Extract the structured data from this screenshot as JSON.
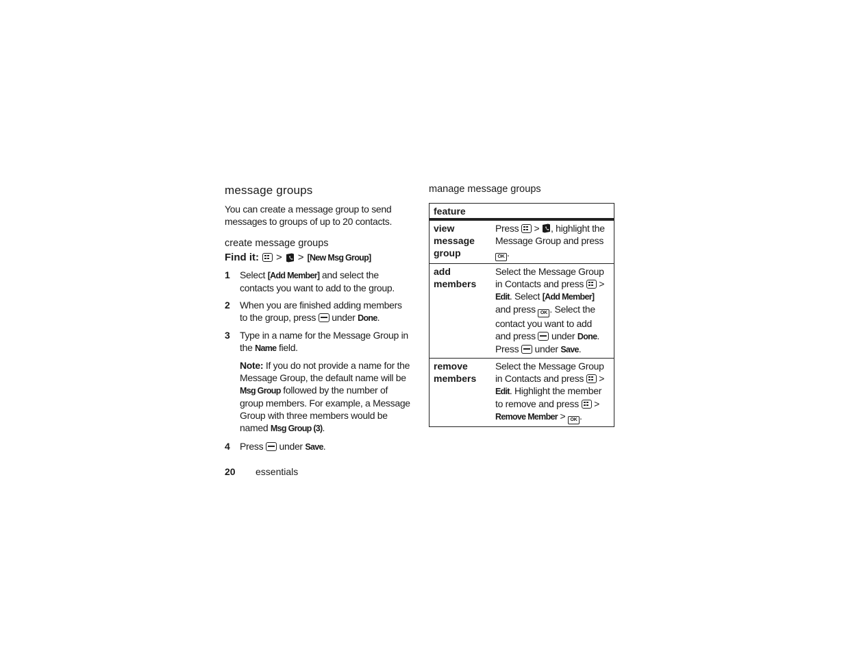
{
  "left": {
    "title": "message groups",
    "intro": "You can create a message group to send messages to groups of up to 20 contacts.",
    "subtitle": "create message groups",
    "find_it": {
      "label": "Find it:",
      "path": [
        "menu-key-icon",
        ">",
        "contacts-icon",
        ">",
        "[New Msg Group]"
      ],
      "sep": ">",
      "target": "[New Msg Group]"
    },
    "steps": [
      {
        "num": "1",
        "a": "Select ",
        "cmd": "[Add Member]",
        "b": " and select the contacts you want to add to the group."
      },
      {
        "num": "2",
        "a": "When you are finished adding members to the group, press ",
        "c": " under ",
        "cmd": "Done",
        "b": "."
      },
      {
        "num": "3",
        "a": "Type in a name for the Message Group in the ",
        "cmd": "Name",
        "b": " field."
      },
      {
        "num": "4",
        "a": "Press ",
        "c": " under ",
        "cmd": "Save",
        "b": "."
      }
    ],
    "note": {
      "label": "Note:",
      "a": " If you do not provide a name for the Message Group, the default name will be ",
      "cmd1": "Msg Group",
      "b": " followed by the number of group members. For example, a Message Group with three members would be named ",
      "cmd2": "Msg Group (3)",
      "c": "."
    }
  },
  "right": {
    "title": "manage message groups",
    "table": {
      "header": "feature",
      "rows": [
        {
          "feature": "view message group",
          "desc": {
            "a": "Press ",
            "gt": " > ",
            "b": ", highlight the Message Group and press ",
            "c": "."
          }
        },
        {
          "feature": "add members",
          "desc": {
            "a": "Select the Message Group in Contacts and press ",
            "gt": " > ",
            "cmd1": "Edit",
            "b": ". Select ",
            "cmd2": "[Add Member]",
            "c": " and press ",
            "d": ". Select the contact you want to add and press ",
            "e": " under ",
            "cmd3": "Done",
            "f": ". Press ",
            "g": " under ",
            "cmd4": "Save",
            "h": "."
          }
        },
        {
          "feature": "remove members",
          "desc": {
            "a": "Select the Message Group in Contacts and press ",
            "gt": " > ",
            "cmd1": "Edit",
            "b": ". Highlight the member to remove and press ",
            "gt2": " > ",
            "cmd2": "Remove Member",
            "gt3": " > ",
            "c": "."
          }
        }
      ]
    }
  },
  "footer": {
    "page": "20",
    "section": "essentials"
  }
}
